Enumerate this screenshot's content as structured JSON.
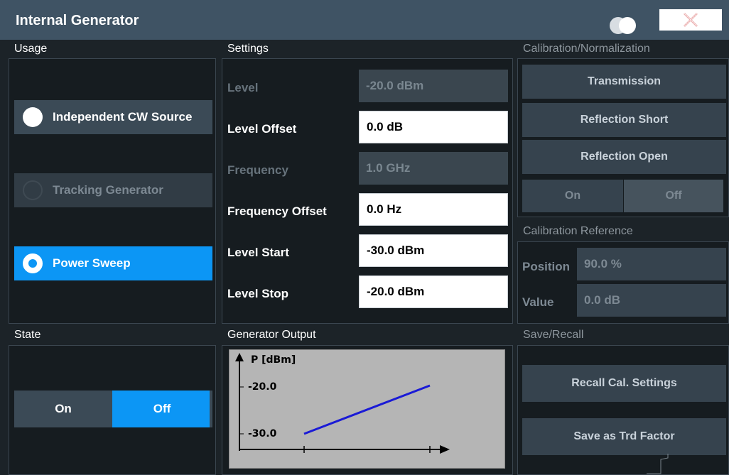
{
  "window": {
    "title": "Internal Generator"
  },
  "usage": {
    "label": "Usage",
    "options": [
      {
        "label": "Independent CW Source",
        "state": "unselected"
      },
      {
        "label": "Tracking Generator",
        "state": "disabled"
      },
      {
        "label": "Power Sweep",
        "state": "selected"
      }
    ]
  },
  "settings": {
    "label": "Settings",
    "level": {
      "label": "Level",
      "value": "-20.0 dBm"
    },
    "level_offset": {
      "label": "Level Offset",
      "value": "0.0 dB"
    },
    "frequency": {
      "label": "Frequency",
      "value": "1.0 GHz"
    },
    "frequency_offset": {
      "label": "Frequency Offset",
      "value": "0.0 Hz"
    },
    "level_start": {
      "label": "Level Start",
      "value": "-30.0 dBm"
    },
    "level_stop": {
      "label": "Level Stop",
      "value": "-20.0 dBm"
    }
  },
  "calibration": {
    "label": "Calibration/Normalization",
    "transmission": "Transmission",
    "reflection_short": "Reflection Short",
    "reflection_open": "Reflection Open",
    "on": "On",
    "off": "Off"
  },
  "cal_reference": {
    "label": "Calibration Reference",
    "position_label": "Position",
    "position_value": "90.0 %",
    "value_label": "Value",
    "value_value": "0.0 dB"
  },
  "state": {
    "label": "State",
    "on": "On",
    "off": "Off",
    "selected": "Off"
  },
  "generator_output": {
    "label": "Generator Output",
    "y_axis_label": "P [dBm]",
    "tick_high": "-20.0",
    "tick_low": "-30.0",
    "line_color": "#1a1ad6"
  },
  "save_recall": {
    "label": "Save/Recall",
    "recall": "Recall Cal. Settings",
    "save": "Save as Trd Factor"
  },
  "colors": {
    "accent": "#0c96f5",
    "titlebar": "#3f5364",
    "background": "#1c2328"
  },
  "icons": {
    "display_toggle": "toggle-circles-icon",
    "close": "close-x-icon"
  }
}
